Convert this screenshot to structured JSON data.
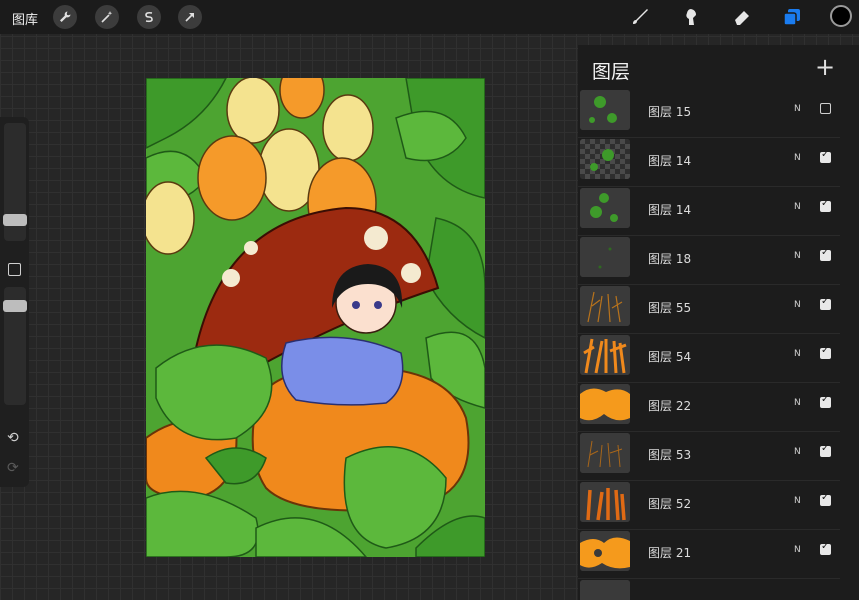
{
  "toolbar": {
    "gallery_label": "图库",
    "left_tools": [
      "wrench-icon",
      "magic-wand-icon",
      "selection-icon",
      "transform-arrow-icon"
    ],
    "right_tools": [
      "brush-icon",
      "smudge-icon",
      "eraser-icon",
      "layers-icon"
    ],
    "active_color": "#000000",
    "accent": "#1a7cf0"
  },
  "layers_panel": {
    "title": "图层",
    "add_label": "+",
    "layers": [
      {
        "name": "图层 15",
        "blend": "N",
        "visible": false,
        "thumb": "green-bits"
      },
      {
        "name": "图层 14",
        "blend": "N",
        "visible": true,
        "thumb": "checker-green"
      },
      {
        "name": "图层 14",
        "blend": "N",
        "visible": true,
        "thumb": "green-bits"
      },
      {
        "name": "图层 18",
        "blend": "N",
        "visible": true,
        "thumb": "dark"
      },
      {
        "name": "图层 55",
        "blend": "N",
        "visible": true,
        "thumb": "orange-lines"
      },
      {
        "name": "图层 54",
        "blend": "N",
        "visible": true,
        "thumb": "orange-strokes"
      },
      {
        "name": "图层 22",
        "blend": "N",
        "visible": true,
        "thumb": "orange-blob"
      },
      {
        "name": "图层 53",
        "blend": "N",
        "visible": true,
        "thumb": "orange-lines"
      },
      {
        "name": "图层 52",
        "blend": "N",
        "visible": true,
        "thumb": "orange-strokes"
      },
      {
        "name": "图层 21",
        "blend": "N",
        "visible": true,
        "thumb": "orange-blob"
      }
    ]
  }
}
